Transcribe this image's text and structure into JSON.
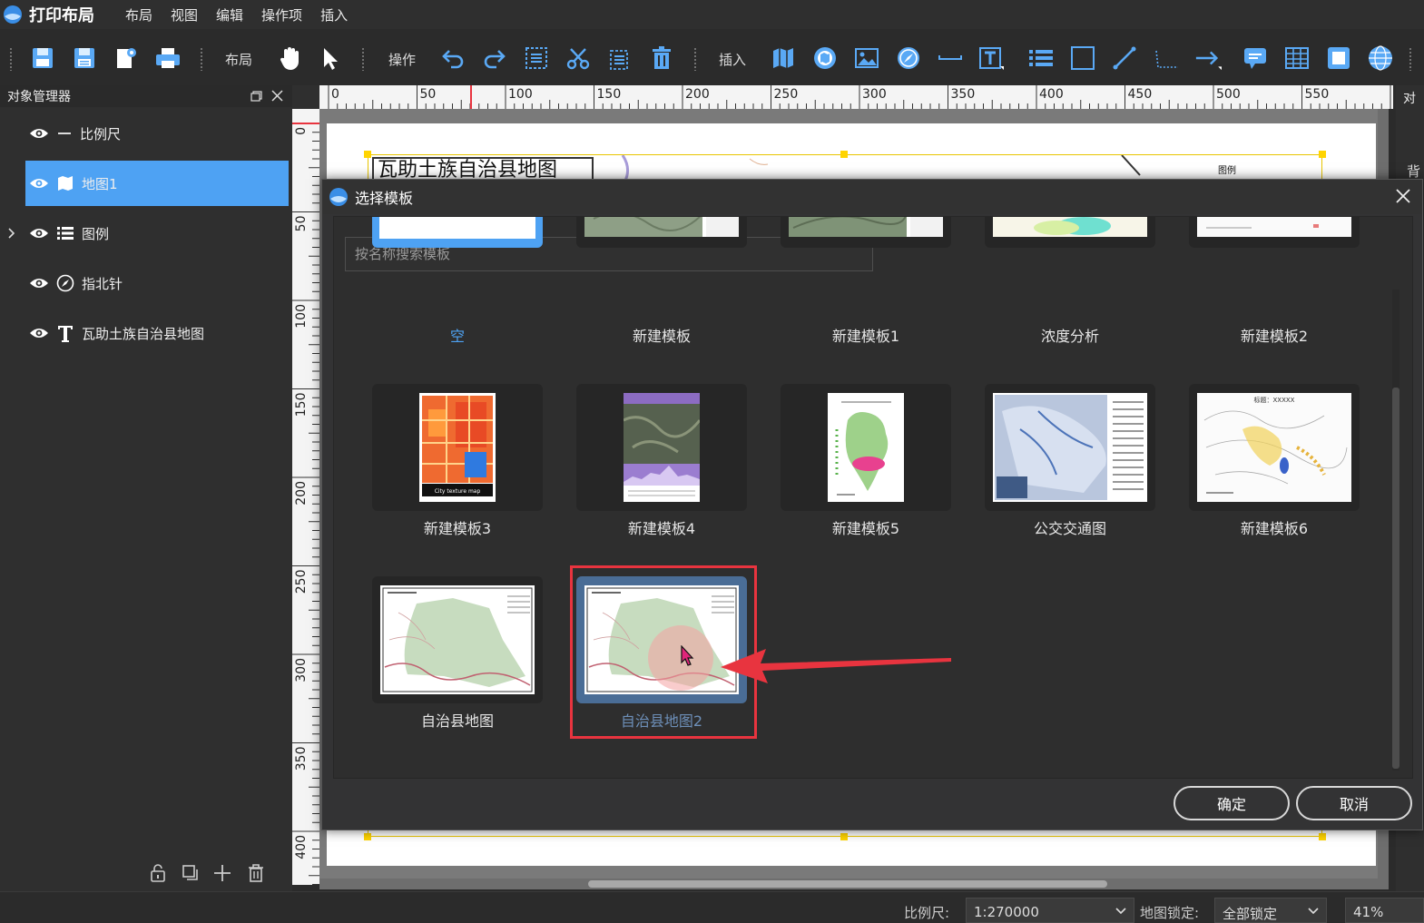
{
  "app": {
    "title": "打印布局"
  },
  "menu": [
    "布局",
    "视图",
    "编辑",
    "操作项",
    "插入"
  ],
  "toolbar": {
    "layout_label": "布局",
    "ops_label": "操作",
    "insert_label": "插入"
  },
  "object_manager": {
    "title": "对象管理器",
    "items": [
      {
        "label": "比例尺",
        "icon": "scalebar-icon"
      },
      {
        "label": "地图1",
        "icon": "map-icon",
        "selected": true
      },
      {
        "label": "图例",
        "icon": "legend-icon",
        "expandable": true
      },
      {
        "label": "指北针",
        "icon": "compass-icon"
      },
      {
        "label": "瓦助土族自治县地图",
        "icon": "text-icon"
      }
    ]
  },
  "right_dock": {
    "title_fragment": "对",
    "tab_fragment": "背"
  },
  "rulers": {
    "h_ticks": [
      "0",
      "50",
      "100",
      "150",
      "200",
      "250",
      "300",
      "350",
      "400",
      "450",
      "500",
      "550",
      "6"
    ],
    "v_ticks": [
      "0",
      "50",
      "100",
      "150",
      "200",
      "250",
      "300",
      "350",
      "400"
    ]
  },
  "canvas": {
    "map_title": "瓦助土族自治县地图",
    "legend_label": "图例"
  },
  "dialog": {
    "title": "选择模板",
    "search_placeholder": "按名称搜索模板",
    "templates_row1": [
      "空",
      "新建模板",
      "新建模板1",
      "浓度分析",
      "新建模板2"
    ],
    "templates_row2": [
      "新建模板3",
      "新建模板4",
      "新建模板5",
      "公交交通图",
      "新建模板6"
    ],
    "templates_row3": [
      "自治县地图",
      "自治县地图2"
    ],
    "thumb_caption": "City texture map",
    "thumb_heading": "标题：XXXXX",
    "selected_template": "自治县地图2",
    "ok_label": "确定",
    "cancel_label": "取消"
  },
  "status": {
    "scale_label": "比例尺:",
    "scale_value": "1:270000",
    "lock_label": "地图锁定:",
    "lock_value": "全部锁定",
    "zoom": "41%"
  },
  "colors": {
    "accent": "#4ea2f3",
    "highlight_red": "#e8343f",
    "selected_tile": "#4a6d96"
  }
}
